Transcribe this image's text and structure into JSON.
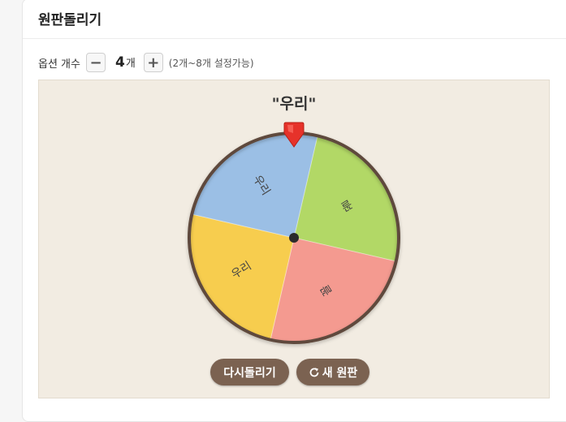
{
  "app": {
    "title": "원판돌리기"
  },
  "options": {
    "label": "옵션 개수",
    "minus": "−",
    "plus": "+",
    "count": "4",
    "unit": "개",
    "hint": "(2개~8개 설정가능)"
  },
  "result": "\"우리\"",
  "wheel": {
    "segments": [
      {
        "label": "꼴",
        "color": "#b2d866"
      },
      {
        "label": "꼴",
        "color": "#f49a90"
      },
      {
        "label": "우리",
        "color": "#f7cd4e"
      },
      {
        "label": "우리",
        "color": "#9bbfe5"
      }
    ],
    "rim_color": "#5e4a3c",
    "pointer_color": "#e6322a"
  },
  "buttons": {
    "respin": "다시돌리기",
    "new_wheel": "새 원판"
  }
}
